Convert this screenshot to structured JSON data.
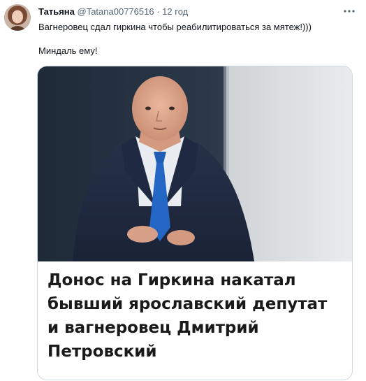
{
  "tweet": {
    "author_name": "Татьяна",
    "author_handle": "@Tatana00776516",
    "separator": "·",
    "time": "12 год",
    "text_lines": [
      "Вагнеровец сдал гиркина чтобы реабилитироваться за мятеж!)))",
      "",
      "Миндаль ему!"
    ]
  },
  "card": {
    "title": "Донос на Гиркина накатал бывший ярославский депутат и вагнеровец Дмитрий Петровский"
  },
  "icons": {
    "more": "more-horizontal-icon"
  },
  "colors": {
    "text": "#0f1419",
    "secondary": "#536471",
    "border": "#cfd9de"
  }
}
